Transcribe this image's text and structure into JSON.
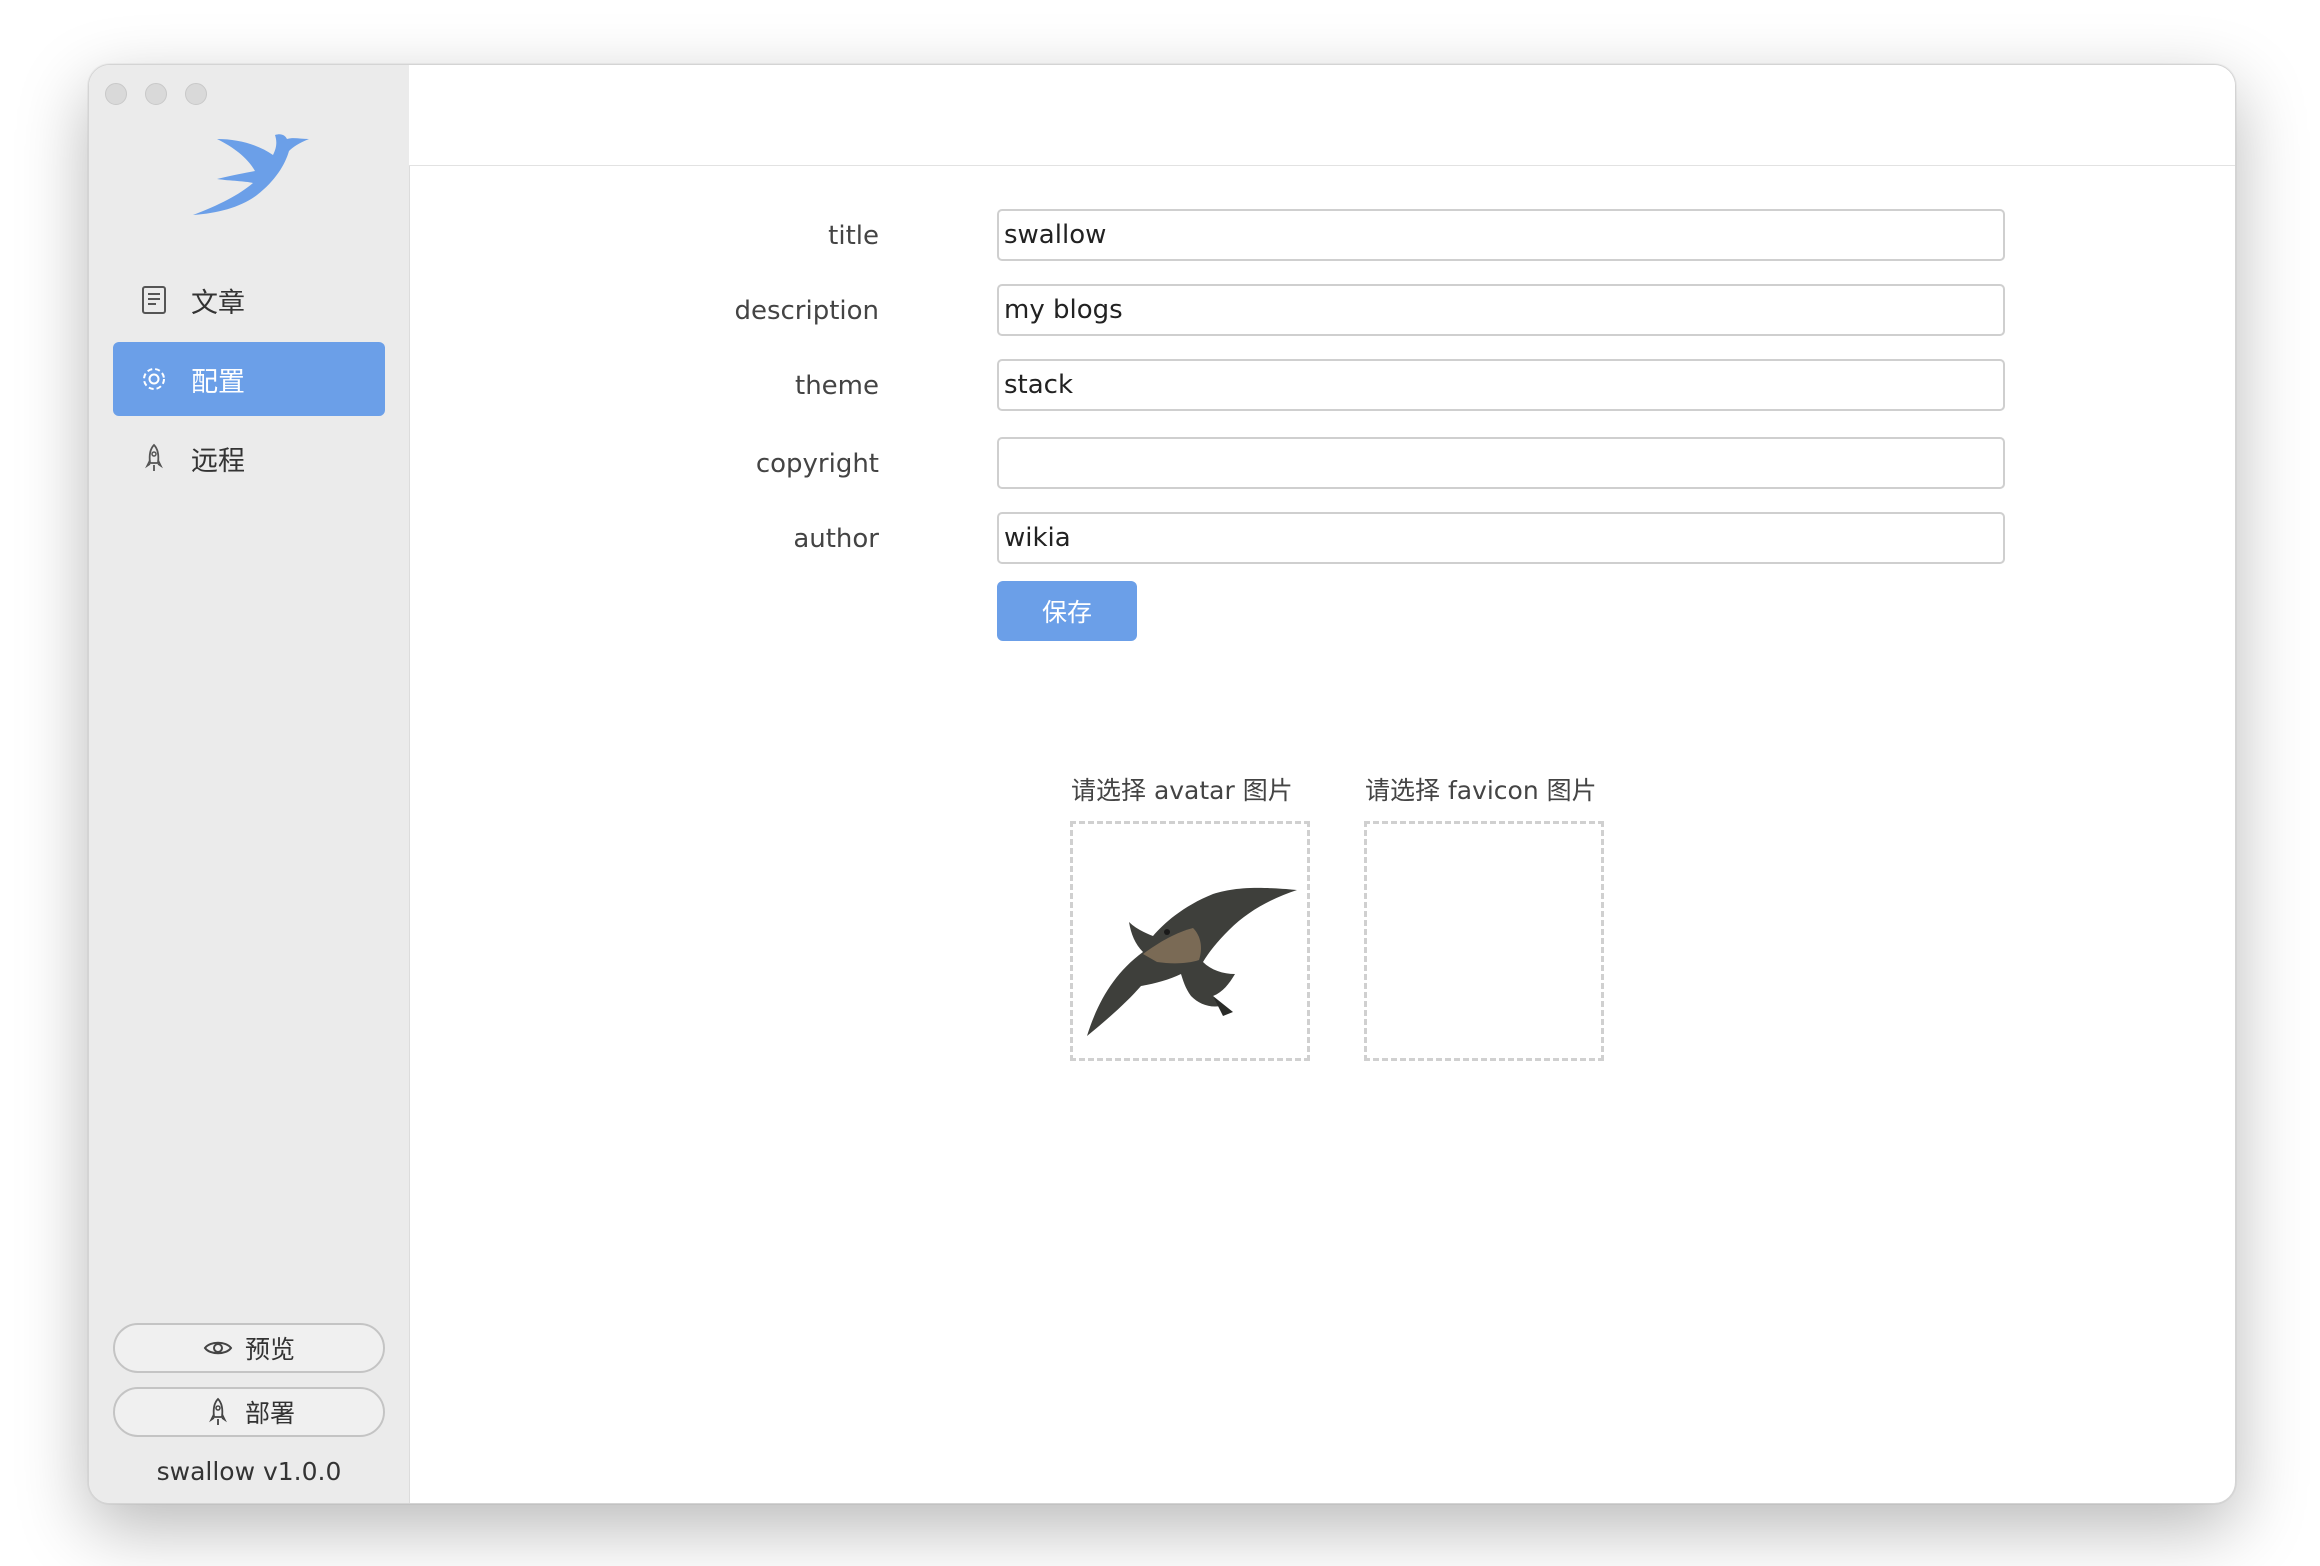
{
  "sidebar": {
    "items": [
      {
        "label": "文章",
        "icon": "document-icon"
      },
      {
        "label": "配置",
        "icon": "gear-icon"
      },
      {
        "label": "远程",
        "icon": "rocket-icon"
      }
    ],
    "preview_label": "预览",
    "deploy_label": "部署",
    "version": "swallow v1.0.0"
  },
  "form": {
    "fields": [
      {
        "label": "title",
        "value": "swallow"
      },
      {
        "label": "description",
        "value": "my blogs"
      },
      {
        "label": "theme",
        "value": "stack"
      },
      {
        "label": "copyright",
        "value": ""
      },
      {
        "label": "author",
        "value": "wikia"
      }
    ],
    "save_label": "保存"
  },
  "uploads": {
    "avatar_label": "请选择 avatar 图片",
    "favicon_label": "请选择 favicon 图片"
  },
  "colors": {
    "accent": "#6b9fe8",
    "sidebar_bg": "#ebebeb"
  }
}
